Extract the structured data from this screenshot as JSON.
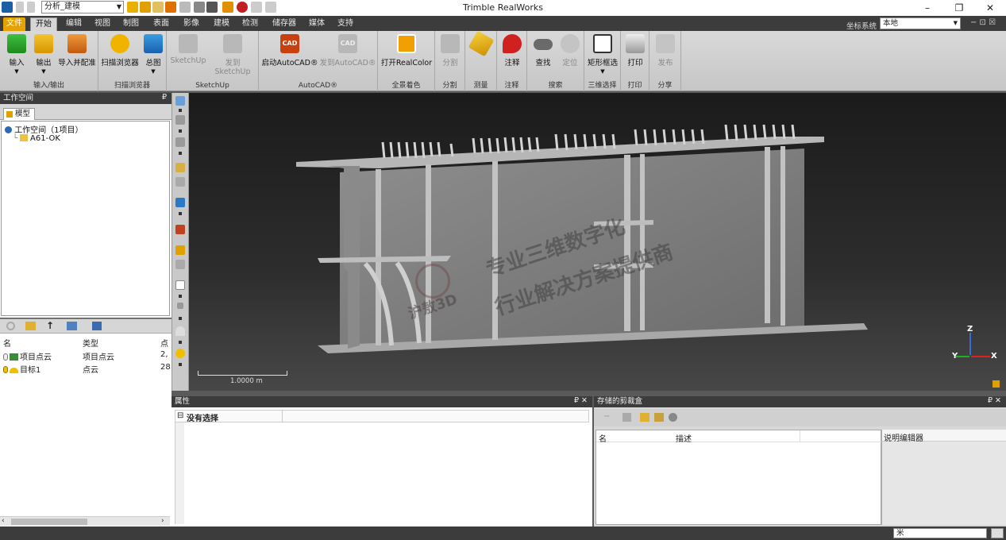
{
  "window": {
    "title": "Trimble RealWorks",
    "minimize": "–",
    "maximize": "❐",
    "close": "✕"
  },
  "quick_access": {
    "combo_value": "分析_建模"
  },
  "tabs": [
    "文件",
    "开始",
    "编辑",
    "视图",
    "制图",
    "表面",
    "影像",
    "建模",
    "检测",
    "储存器",
    "媒体",
    "支持"
  ],
  "coord": {
    "label": "坐标系统",
    "value": "本地"
  },
  "ribbon": {
    "groups": [
      {
        "name": "输入/输出",
        "buttons": [
          "输入",
          "输出",
          "导入并配准"
        ]
      },
      {
        "name": "扫描浏览器",
        "buttons": [
          "扫描浏览器",
          "总图"
        ]
      },
      {
        "name": "SketchUp",
        "buttons": [
          "SketchUp",
          "发到SketchUp"
        ]
      },
      {
        "name": "AutoCAD®",
        "buttons": [
          "启动AutoCAD®",
          "发到AutoCAD®"
        ]
      },
      {
        "name": "全景着色",
        "buttons": [
          "打开RealColor"
        ]
      },
      {
        "name": "分割",
        "buttons": [
          "分割"
        ]
      },
      {
        "name": "测量",
        "buttons": [
          ""
        ]
      },
      {
        "name": "注释",
        "buttons": [
          "注释"
        ]
      },
      {
        "name": "搜索",
        "buttons": [
          "查找",
          "定位"
        ]
      },
      {
        "name": "三维选择",
        "buttons": [
          "矩形框选"
        ]
      },
      {
        "name": "打印",
        "buttons": [
          "打印"
        ]
      },
      {
        "name": "分享",
        "buttons": [
          "发布"
        ]
      }
    ],
    "cad_badge": "CAD"
  },
  "workspace": {
    "title": "工作空间",
    "pin": "₽",
    "tab": "模型",
    "root": "工作空间（1项目）",
    "child": "A61-OK"
  },
  "object_list": {
    "headers": [
      "名",
      "类型",
      "点"
    ],
    "rows": [
      {
        "name": "项目点云",
        "type": "项目点云",
        "pts": "2,"
      },
      {
        "name": "目标1",
        "type": "点云",
        "pts": "28"
      }
    ]
  },
  "viewport": {
    "scale_label": "1.0000 m",
    "watermark_line1": "专业三维数字化",
    "watermark_line2": "行业解决方案提供商",
    "watermark_brand": "沪敖3D",
    "axis_z": "Z",
    "axis_x": "X",
    "axis_y": "Y"
  },
  "properties": {
    "title": "属性",
    "row_label": "没有选择",
    "expander": "⊟"
  },
  "clipboxes": {
    "title": "存储的剪裁盒",
    "col_name": "名",
    "col_desc": "描述",
    "editor": "说明编辑器"
  },
  "status": {
    "unit": "米"
  }
}
